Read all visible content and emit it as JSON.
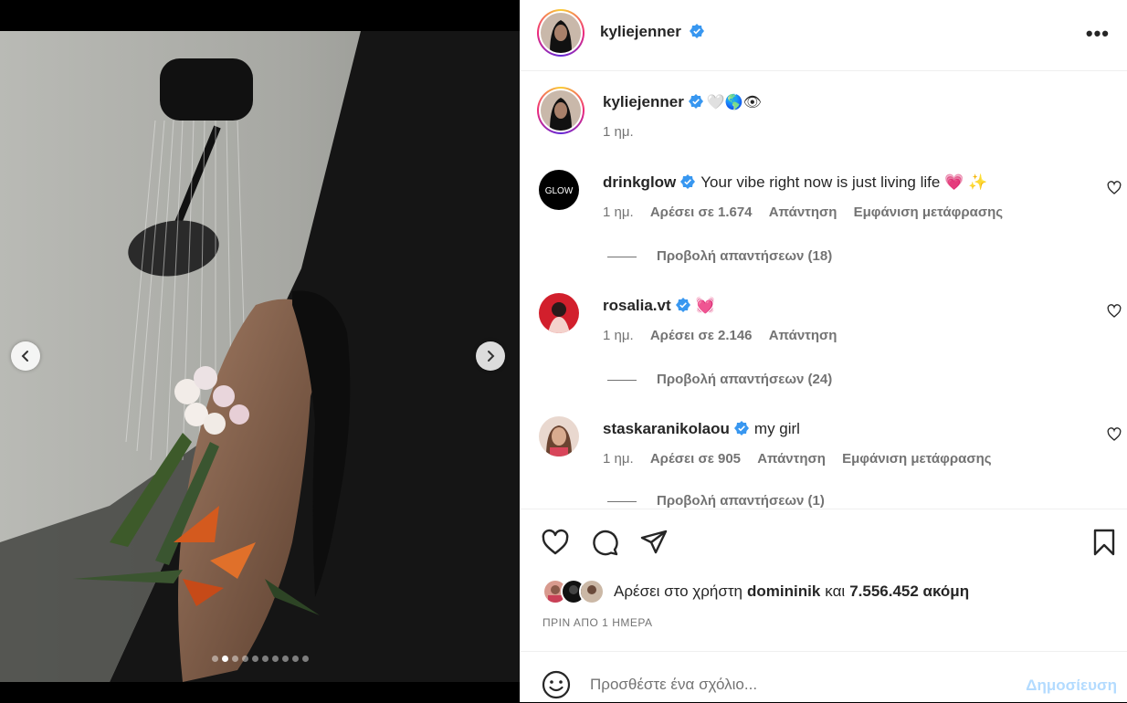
{
  "post": {
    "username": "kyliejenner",
    "caption_emojis": "🤍🌎👁",
    "caption_time": "1 ημ.",
    "more_icon": "more-horizontal-icon",
    "media": {
      "slide_count": 10,
      "active_slide": 1
    }
  },
  "comments": [
    {
      "username": "drinkglow",
      "avatar_label": "GLOW",
      "text": "Your vibe right now is just living life 💗 ✨",
      "time": "1 ημ.",
      "likes": "Αρέσει σε 1.674",
      "reply": "Απάντηση",
      "translate": "Εμφάνιση μετάφρασης",
      "view_replies": "Προβολή απαντήσεων (18)"
    },
    {
      "username": "rosalia.vt",
      "text": "💓",
      "time": "1 ημ.",
      "likes": "Αρέσει σε 2.146",
      "reply": "Απάντηση",
      "view_replies": "Προβολή απαντήσεων (24)"
    },
    {
      "username": "staskaranikolaou",
      "text": "my girl",
      "time": "1 ημ.",
      "likes": "Αρέσει σε 905",
      "reply": "Απάντηση",
      "translate": "Εμφάνιση μετάφρασης",
      "view_replies": "Προβολή απαντήσεων (1)"
    }
  ],
  "likes": {
    "prefix": "Αρέσει στο χρήστη",
    "user": "domininik",
    "conjunction": "και",
    "count": "7.556.452 ακόμη"
  },
  "timeago": "ΠΡΙΝ ΑΠΟ 1 ΗΜΕΡΑ",
  "add_comment": {
    "placeholder": "Προσθέστε ένα σχόλιο...",
    "post_label": "Δημοσίευση"
  },
  "colors": {
    "verified": "#3897f0",
    "post_button_disabled": "#b3dbff",
    "secondary_text": "#737373"
  }
}
